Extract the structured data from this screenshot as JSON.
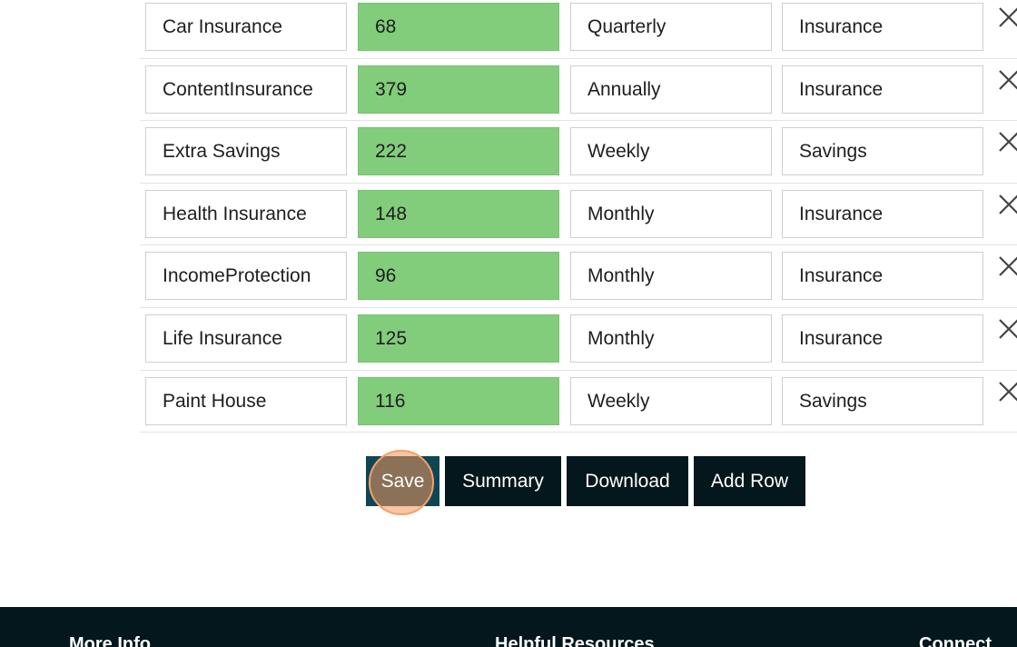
{
  "rows": [
    {
      "name": "Car Insurance",
      "amount": "68",
      "frequency": "Quarterly",
      "category": "Insurance"
    },
    {
      "name": "ContentInsurance",
      "amount": "379",
      "frequency": "Annually",
      "category": "Insurance"
    },
    {
      "name": "Extra Savings",
      "amount": "222",
      "frequency": "Weekly",
      "category": "Savings"
    },
    {
      "name": "Health Insurance",
      "amount": "148",
      "frequency": "Monthly",
      "category": "Insurance"
    },
    {
      "name": "IncomeProtection",
      "amount": "96",
      "frequency": "Monthly",
      "category": "Insurance"
    },
    {
      "name": "Life Insurance",
      "amount": "125",
      "frequency": "Monthly",
      "category": "Insurance"
    },
    {
      "name": "Paint House",
      "amount": "116",
      "frequency": "Weekly",
      "category": "Savings"
    }
  ],
  "actions": {
    "save": "Save",
    "summary": "Summary",
    "download": "Download",
    "add_row": "Add Row"
  },
  "footer": {
    "col1": "More Info",
    "col2": "Helpful Resources",
    "col3": "Connect"
  },
  "colors": {
    "amount_bg": "#82cd7b",
    "button_bg": "#04171d",
    "save_bg": "#0f4656",
    "focus_ring": "#f3a26b",
    "footer_bg": "#04171d"
  },
  "icons": {
    "delete": "close-icon"
  }
}
